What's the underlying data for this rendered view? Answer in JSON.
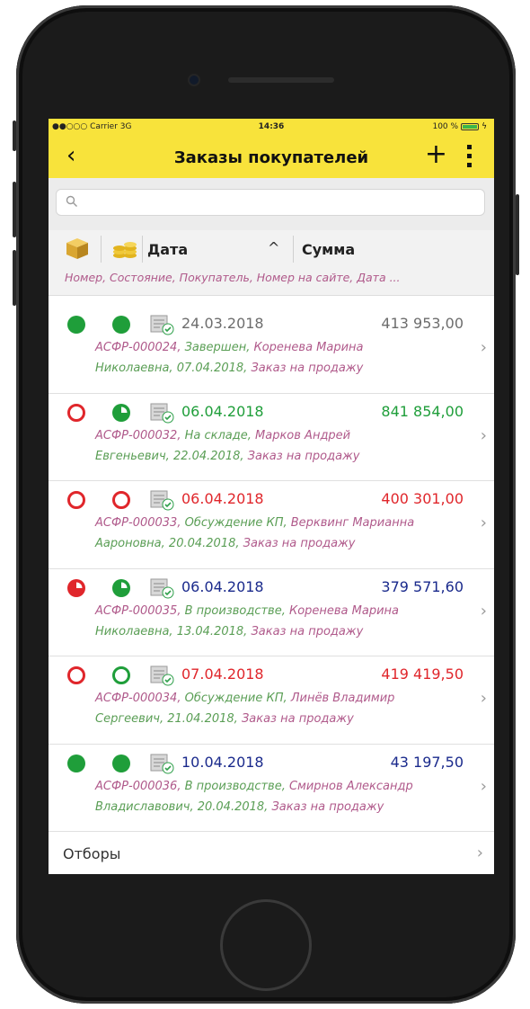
{
  "status_bar": {
    "carrier": "●●○○○ Carrier  3G",
    "time": "14:36",
    "battery": "100 %"
  },
  "nav": {
    "back_icon": "chevron-left-icon",
    "title": "Заказы покупателей",
    "add_icon": "plus-icon",
    "more_icon": "more-vertical-icon"
  },
  "search": {
    "placeholder": "",
    "value": ""
  },
  "columns": {
    "box_icon": "package-icon",
    "coins_icon": "coins-icon",
    "date": "Дата",
    "sort_indicator": "^",
    "sum": "Сумма",
    "subtitle": "Номер, Состояние, Покупатель, Номер на сайте, Дата ..."
  },
  "orders": [
    {
      "icon1": "filled",
      "icon2": "filled",
      "date": "24.03.2018",
      "sum": "413 953,00",
      "value_color": "#6d6d6d",
      "number": "АСФР-000024,",
      "state": "Завершен,",
      "customer_part1": "Коренева Марина",
      "customer_part2": "Николаевна,",
      "due": "07.04.2018,",
      "kind": "Заказ на продажу"
    },
    {
      "icon1": "outline-red",
      "icon2": "pie-green",
      "date": "06.04.2018",
      "sum": "841 854,00",
      "value_color": "#1f9e3a",
      "number": "АСФР-000032,",
      "state": "На складе,",
      "customer_part1": "Марков Андрей",
      "customer_part2": "Евгеньевич,",
      "due": "22.04.2018,",
      "kind": "Заказ на продажу"
    },
    {
      "icon1": "outline-red",
      "icon2": "outline-red",
      "date": "06.04.2018",
      "sum": "400 301,00",
      "value_color": "#e0262b",
      "number": "АСФР-000033,",
      "state": "Обсуждение КП,",
      "customer_part1": "Верквинг Марианна",
      "customer_part2": "Аароновна,",
      "due": "20.04.2018,",
      "kind": "Заказ на продажу"
    },
    {
      "icon1": "pie-red",
      "icon2": "pie-green",
      "date": "06.04.2018",
      "sum": "379 571,60",
      "value_color": "#1a2a8c",
      "number": "АСФР-000035,",
      "state": "В производстве,",
      "customer_part1": "Коренева Марина",
      "customer_part2": "Николаевна,",
      "due": "13.04.2018,",
      "kind": "Заказ на продажу"
    },
    {
      "icon1": "outline-red",
      "icon2": "outline-green",
      "date": "07.04.2018",
      "sum": "419 419,50",
      "value_color": "#e0262b",
      "number": "АСФР-000034,",
      "state": "Обсуждение КП,",
      "customer_part1": "Линёв Владимир",
      "customer_part2": "Сергеевич,",
      "due": "21.04.2018,",
      "kind": "Заказ на продажу"
    },
    {
      "icon1": "filled",
      "icon2": "filled",
      "date": "10.04.2018",
      "sum": "43 197,50",
      "value_color": "#1a2a8c",
      "number": "АСФР-000036,",
      "state": "В производстве,",
      "customer_part1": "Смирнов Александр",
      "customer_part2": "Владиславович,",
      "due": "20.04.2018,",
      "kind": "Заказ на продажу"
    }
  ],
  "filters": {
    "label": "Отборы"
  },
  "colors": {
    "accent": "#f8e33b",
    "pink_text": "#b05a8b",
    "green_text": "#5a9e55",
    "status_green": "#1f9e3a",
    "status_red": "#e0262b"
  }
}
